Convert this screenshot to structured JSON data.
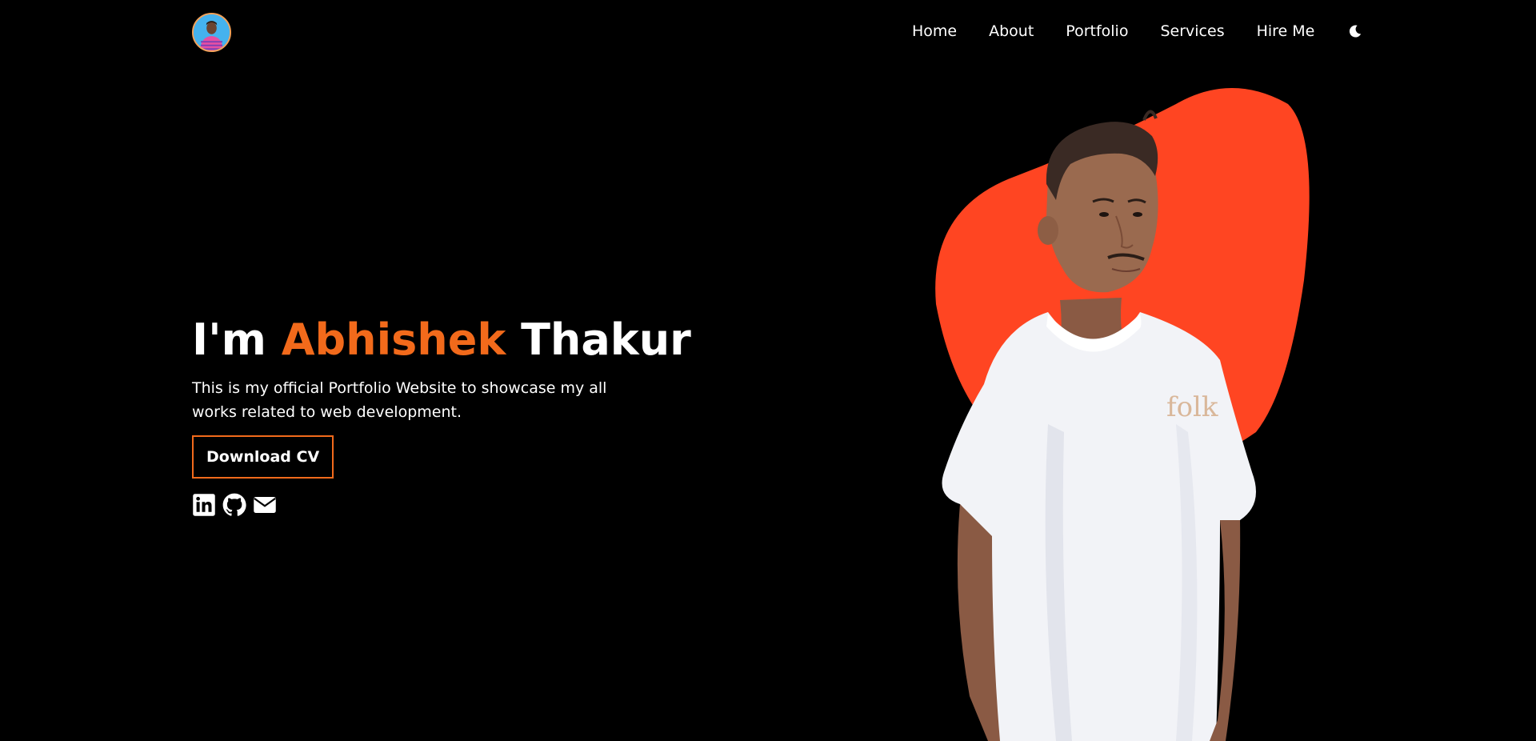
{
  "brand": {
    "accent": "#f26a1b",
    "blob_color": "#ff4522",
    "background": "#000000"
  },
  "nav": {
    "items": [
      {
        "label": "Home"
      },
      {
        "label": "About"
      },
      {
        "label": "Portfolio"
      },
      {
        "label": "Services"
      },
      {
        "label": "Hire Me"
      }
    ],
    "theme_toggle_icon": "moon-icon"
  },
  "hero": {
    "title_prefix": "I'm",
    "title_first": "Abhishek",
    "title_last": "Thakur",
    "description": "This is my official Portfolio Website to showcase my all works related to web development.",
    "cta_label": "Download CV",
    "socials": [
      {
        "icon": "linkedin-icon"
      },
      {
        "icon": "github-icon"
      },
      {
        "icon": "envelope-icon"
      }
    ],
    "shirt_logo": "folk"
  }
}
